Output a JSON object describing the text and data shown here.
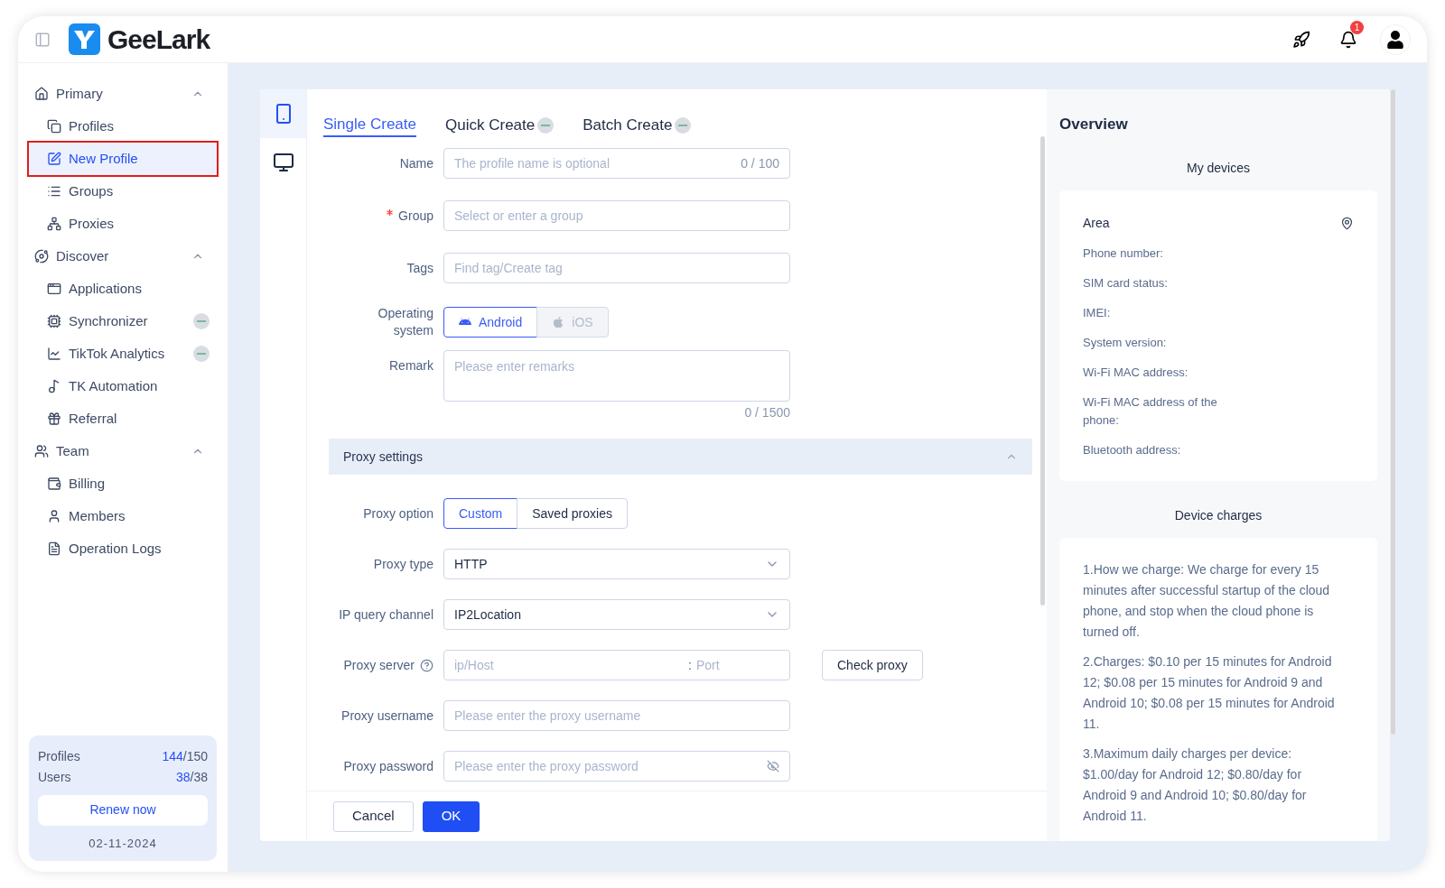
{
  "header": {
    "logo": "GeeLark",
    "notification_count": "1"
  },
  "sidebar": {
    "sections": [
      {
        "title": "Primary",
        "expanded": true,
        "items": [
          {
            "label": "Profiles",
            "selected": false,
            "highlighted": false,
            "badge": false
          },
          {
            "label": "New Profile",
            "selected": true,
            "highlighted": true,
            "badge": false
          },
          {
            "label": "Groups",
            "selected": false,
            "highlighted": false,
            "badge": false
          },
          {
            "label": "Proxies",
            "selected": false,
            "highlighted": false,
            "badge": false
          }
        ]
      },
      {
        "title": "Discover",
        "expanded": true,
        "items": [
          {
            "label": "Applications",
            "selected": false,
            "highlighted": false,
            "badge": false
          },
          {
            "label": "Synchronizer",
            "selected": false,
            "highlighted": false,
            "badge": true
          },
          {
            "label": "TikTok Analytics",
            "selected": false,
            "highlighted": false,
            "badge": true
          },
          {
            "label": "TK Automation",
            "selected": false,
            "highlighted": false,
            "badge": false
          },
          {
            "label": "Referral",
            "selected": false,
            "highlighted": false,
            "badge": false
          }
        ]
      },
      {
        "title": "Team",
        "expanded": true,
        "items": [
          {
            "label": "Billing",
            "selected": false,
            "highlighted": false,
            "badge": false
          },
          {
            "label": "Members",
            "selected": false,
            "highlighted": false,
            "badge": false
          },
          {
            "label": "Operation Logs",
            "selected": false,
            "highlighted": false,
            "badge": false
          }
        ]
      }
    ],
    "usage": {
      "rows": [
        {
          "label": "Profiles",
          "used": "144",
          "total": "/150"
        },
        {
          "label": "Users",
          "used": "38",
          "total": "/38"
        }
      ],
      "renew": "Renew now",
      "date": "02-11-2024"
    }
  },
  "device_types": [
    {
      "kind": "phone",
      "selected": true
    },
    {
      "kind": "desktop",
      "selected": false
    }
  ],
  "tabs": [
    {
      "label": "Single Create",
      "selected": true,
      "badge": false
    },
    {
      "label": "Quick Create",
      "selected": false,
      "badge": true
    },
    {
      "label": "Batch Create",
      "selected": false,
      "badge": true
    }
  ],
  "form": {
    "fields": [
      {
        "kind": "input",
        "label": "Name",
        "required": false,
        "placeholder": "The profile name is optional",
        "counter": "0 / 100"
      },
      {
        "kind": "input",
        "label": "Group",
        "required": true,
        "placeholder": "Select or enter a group"
      },
      {
        "kind": "input",
        "label": "Tags",
        "required": false,
        "placeholder": "Find tag/Create tag"
      },
      {
        "kind": "platform",
        "label": "Operating system",
        "required": false,
        "options": [
          {
            "label": "Android",
            "selected": true,
            "disabled": false
          },
          {
            "label": "iOS",
            "selected": false,
            "disabled": true
          }
        ]
      },
      {
        "kind": "textarea",
        "label": "Remark",
        "required": false,
        "placeholder": "Please enter remarks",
        "counter": "0 / 1500"
      }
    ],
    "proxy_section": {
      "title": "Proxy settings",
      "expanded": true,
      "fields": [
        {
          "kind": "segmented",
          "label": "Proxy option",
          "required": false,
          "options": [
            {
              "label": "Custom",
              "selected": true,
              "disabled": false
            },
            {
              "label": "Saved proxies",
              "selected": false,
              "disabled": false
            }
          ]
        },
        {
          "kind": "select",
          "label": "Proxy type",
          "required": false,
          "value": "HTTP"
        },
        {
          "kind": "select",
          "label": "IP query channel",
          "required": false,
          "value": "IP2Location"
        },
        {
          "kind": "server",
          "label": "Proxy server",
          "required": false,
          "help": true,
          "placeholder": "ip/Host",
          "separator": ":",
          "port_placeholder": "Port",
          "action": "Check proxy"
        },
        {
          "kind": "input",
          "label": "Proxy username",
          "required": false,
          "placeholder": "Please enter the proxy username"
        },
        {
          "kind": "password",
          "label": "Proxy password",
          "required": false,
          "placeholder": "Please enter the proxy password"
        }
      ]
    }
  },
  "footer_buttons": [
    {
      "label": "Cancel",
      "kind": "secondary"
    },
    {
      "label": "OK",
      "kind": "primary"
    }
  ],
  "overview": {
    "title": "Overview",
    "devices": {
      "title": "My devices",
      "heading": "Area",
      "fields": [
        "Phone number:",
        "SIM card status:",
        "IMEI:",
        "System version:",
        "Wi-Fi MAC address:",
        "Wi-Fi MAC address of the phone:",
        "Bluetooth address:"
      ]
    },
    "charges": {
      "title": "Device charges",
      "paragraphs": [
        "1.How we charge: We charge for every 15 minutes after successful startup of the cloud phone, and stop when the cloud phone is turned off.",
        "2.Charges: $0.10 per 15 minutes for Android 12; $0.08 per 15 minutes for Android 9 and Android 10; $0.08 per 15 minutes for Android 11.",
        "3.Maximum daily charges per device: $1.00/day for Android 12; $0.80/day for Android 9 and Android 10; $0.80/day for Android 11."
      ]
    }
  }
}
